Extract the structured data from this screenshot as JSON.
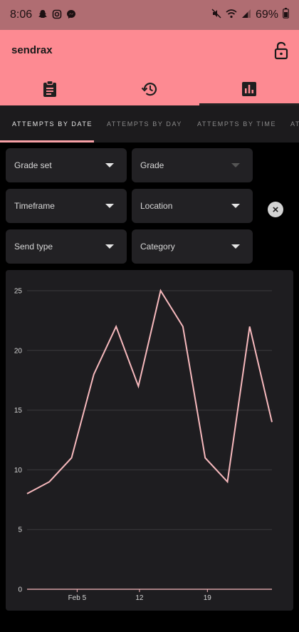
{
  "status_bar": {
    "time": "8:06",
    "left_icons": [
      "snapchat-icon",
      "instagram-icon",
      "messenger-icon"
    ],
    "right_icons": [
      "mute-icon",
      "wifi-icon",
      "signal-icon"
    ],
    "battery_percent": "69%"
  },
  "app_bar": {
    "title": "sendrax",
    "colors": {
      "app_bar_bg": "#fd8a92",
      "accent": "#f7a0a6"
    }
  },
  "top_tabs": [
    {
      "icon": "clipboard-icon",
      "active": false
    },
    {
      "icon": "history-icon",
      "active": false
    },
    {
      "icon": "bar-chart-icon",
      "active": true
    }
  ],
  "sub_tabs": [
    {
      "label": "ATTEMPTS BY DATE",
      "active": true
    },
    {
      "label": "ATTEMPTS BY DAY",
      "active": false
    },
    {
      "label": "ATTEMPTS BY TIME",
      "active": false
    },
    {
      "label": "AT",
      "active": false
    }
  ],
  "filters": {
    "grade_set": "Grade set",
    "grade": "Grade",
    "timeframe": "Timeframe",
    "location": "Location",
    "send_type": "Send type",
    "category": "Category"
  },
  "chart_data": {
    "type": "line",
    "x_tick_labels": [
      "Feb 5",
      "12",
      "19"
    ],
    "y_tick_labels": [
      "0",
      "5",
      "10",
      "15",
      "20",
      "25"
    ],
    "ylim": [
      0,
      25
    ],
    "grid": true,
    "series": [
      {
        "color": "#f7b9bd",
        "values": [
          8,
          9,
          11,
          18,
          22,
          17,
          25,
          22,
          11,
          9,
          22,
          14
        ]
      }
    ]
  }
}
